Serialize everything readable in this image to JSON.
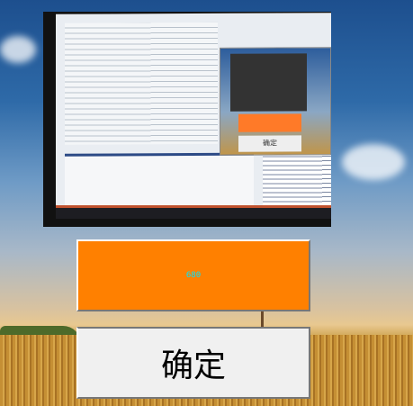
{
  "background": {
    "description_icon": "wallpaper-sky-wheat-field"
  },
  "preview": {
    "screen_caption": "确定"
  },
  "value_display": {
    "text": "680",
    "background": "#ff8000",
    "text_color": "#00e5ff"
  },
  "confirm_button": {
    "label": "确定"
  }
}
